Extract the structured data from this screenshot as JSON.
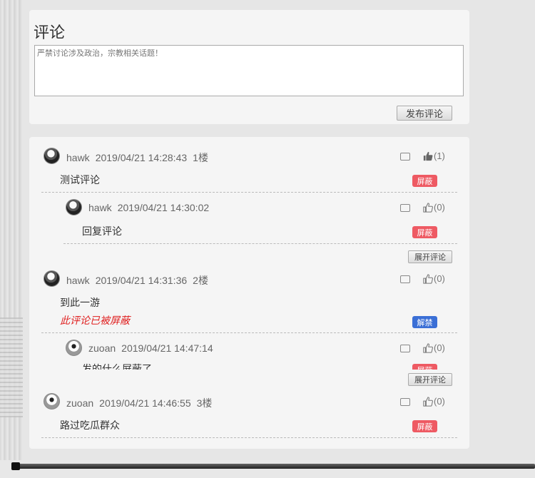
{
  "compose": {
    "title": "评论",
    "placeholder": "严禁讨论涉及政治，宗教相关话题！",
    "post_button": "发布评论"
  },
  "comments": [
    {
      "user": "hawk",
      "time": "2019/04/21 14:28:43",
      "floor": "1楼",
      "text": "测试评论",
      "likes": "(1)",
      "badge": "屏蔽"
    },
    {
      "user": "hawk",
      "time": "2019/04/21 14:30:02",
      "text": "回复评论",
      "likes": "(0)",
      "badge": "屏蔽"
    },
    {
      "user": "hawk",
      "time": "2019/04/21 14:31:36",
      "floor": "2楼",
      "text": "到此一游",
      "blocked_notice": "此评论已被屏蔽",
      "likes": "(0)",
      "badge": "解禁"
    },
    {
      "user": "zuoan",
      "time": "2019/04/21 14:47:14",
      "text": "发的什么屏蔽了",
      "likes": "(0)",
      "badge": "屏蔽"
    },
    {
      "user": "zuoan",
      "time": "2019/04/21 14:46:55",
      "floor": "3楼",
      "text": "路过吃瓜群众",
      "likes": "(0)",
      "badge": "屏蔽"
    }
  ],
  "expand_label": "展开评论",
  "colors": {
    "badge_block": "#ee5a63",
    "badge_unblock": "#3b6fd6",
    "blocked_text": "#e02020"
  }
}
